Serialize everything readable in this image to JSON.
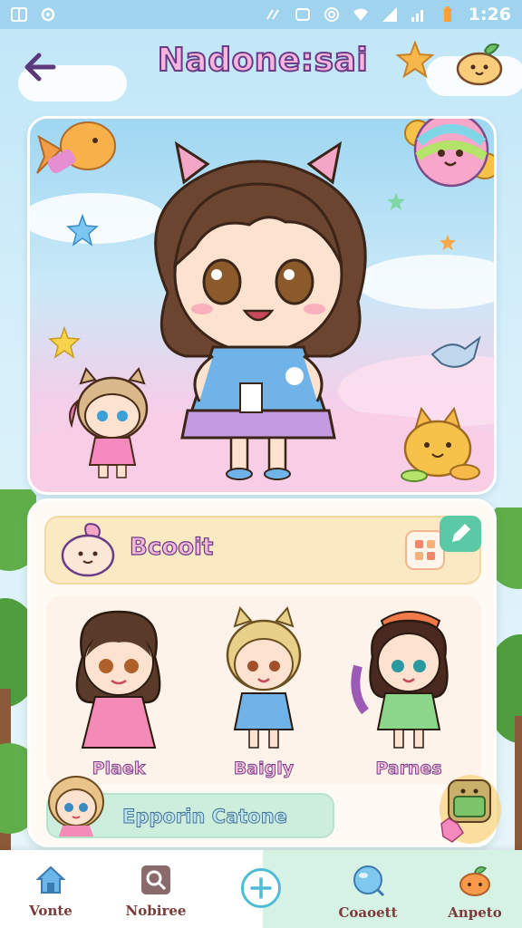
{
  "status_bar": {
    "time": "1:26"
  },
  "header": {
    "title": "Nadone:sai",
    "back_icon": "arrow-left-icon"
  },
  "boost": {
    "label": "Bcooit"
  },
  "roster": {
    "characters": [
      {
        "name": "Plaek"
      },
      {
        "name": "Baigly"
      },
      {
        "name": "Parnes"
      }
    ]
  },
  "explore": {
    "label": "Epporin Catone"
  },
  "bottom_nav": {
    "items": [
      {
        "label": "Vonte",
        "icon": "home-icon"
      },
      {
        "label": "Nobiree",
        "icon": "search-icon"
      },
      {
        "label": "",
        "icon": "plus-icon"
      },
      {
        "label": "Coaoett",
        "icon": "globe-icon"
      },
      {
        "label": "Anpeto",
        "icon": "fruit-icon"
      }
    ]
  },
  "colors": {
    "accent": "#4fbcd6",
    "title_fill": "#f7b6df",
    "title_stroke": "#6b3b86",
    "nav_active_bg": "#d6f2e4"
  }
}
